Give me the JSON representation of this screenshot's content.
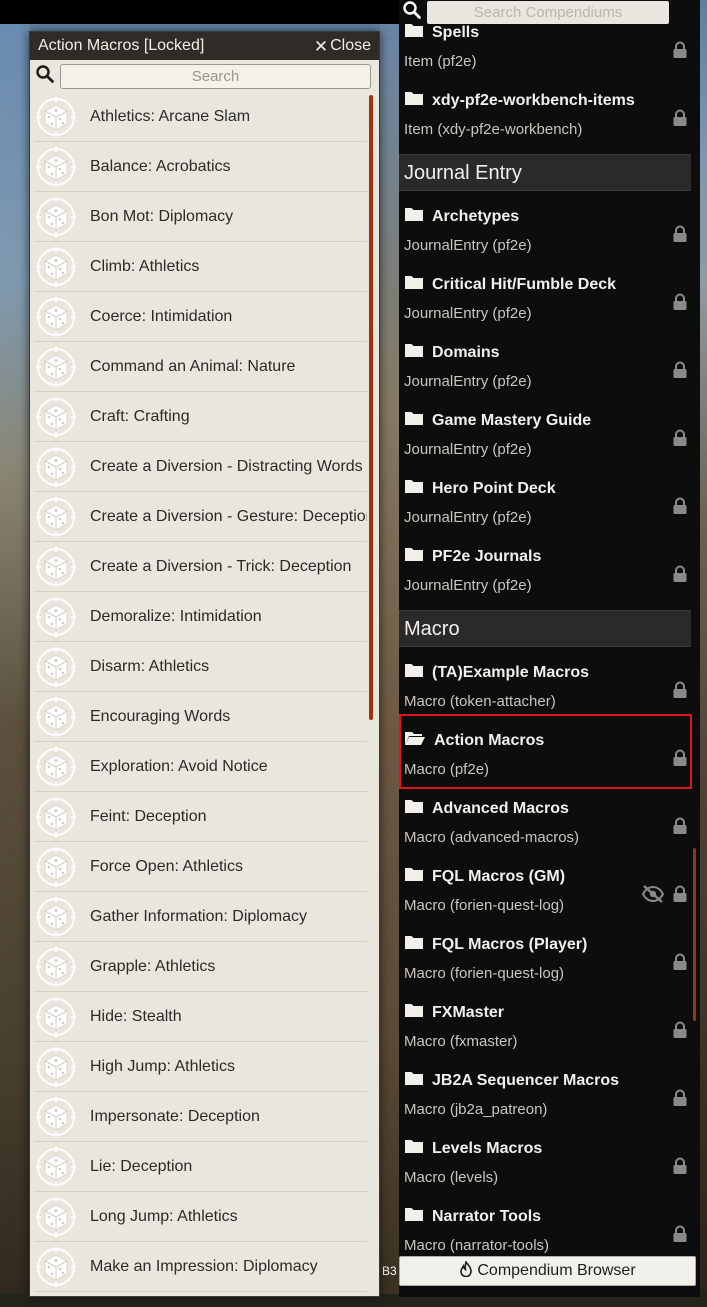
{
  "macro_window": {
    "title": "Action Macros [Locked]",
    "close_label": "Close",
    "search_placeholder": "Search",
    "items": [
      "Athletics: Arcane Slam",
      "Balance: Acrobatics",
      "Bon Mot: Diplomacy",
      "Climb: Athletics",
      "Coerce: Intimidation",
      "Command an Animal: Nature",
      "Craft: Crafting",
      "Create a Diversion - Distracting Words",
      "Create a Diversion - Gesture: Deception",
      "Create a Diversion - Trick: Deception",
      "Demoralize: Intimidation",
      "Disarm: Athletics",
      "Encouraging Words",
      "Exploration: Avoid Notice",
      "Feint: Deception",
      "Force Open: Athletics",
      "Gather Information: Diplomacy",
      "Grapple: Athletics",
      "Hide: Stealth",
      "High Jump: Athletics",
      "Impersonate: Deception",
      "Lie: Deception",
      "Long Jump: Athletics",
      "Make an Impression: Diplomacy"
    ]
  },
  "compendium": {
    "search_placeholder": "Search Compendiums",
    "top_partial": {
      "name": "Spells",
      "sub": "Item (pf2e)"
    },
    "item_entries": [
      {
        "name": "xdy-pf2e-workbench-items",
        "sub": "Item (xdy-pf2e-workbench)"
      }
    ],
    "journal_header": "Journal Entry",
    "journal_entries": [
      {
        "name": "Archetypes",
        "sub": "JournalEntry (pf2e)"
      },
      {
        "name": "Critical Hit/Fumble Deck",
        "sub": "JournalEntry (pf2e)"
      },
      {
        "name": "Domains",
        "sub": "JournalEntry (pf2e)"
      },
      {
        "name": "Game Mastery Guide",
        "sub": "JournalEntry (pf2e)"
      },
      {
        "name": "Hero Point Deck",
        "sub": "JournalEntry (pf2e)"
      },
      {
        "name": "PF2e Journals",
        "sub": "JournalEntry (pf2e)"
      }
    ],
    "macro_header": "Macro",
    "macro_entries": [
      {
        "name": "(TA)Example Macros",
        "sub": "Macro (token-attacher)"
      },
      {
        "name": "Action Macros",
        "sub": "Macro (pf2e)"
      },
      {
        "name": "Advanced Macros",
        "sub": "Macro (advanced-macros)"
      },
      {
        "name": "FQL Macros (GM)",
        "sub": "Macro (forien-quest-log)"
      },
      {
        "name": "FQL Macros (Player)",
        "sub": "Macro (forien-quest-log)"
      },
      {
        "name": "FXMaster",
        "sub": "Macro (fxmaster)"
      },
      {
        "name": "JB2A Sequencer Macros",
        "sub": "Macro (jb2a_patreon)"
      },
      {
        "name": "Levels Macros",
        "sub": "Macro (levels)"
      },
      {
        "name": "Narrator Tools",
        "sub": "Macro (narrator-tools)"
      }
    ],
    "footer_label": "Compendium Browser"
  },
  "background": {
    "partial_text": "B3"
  }
}
